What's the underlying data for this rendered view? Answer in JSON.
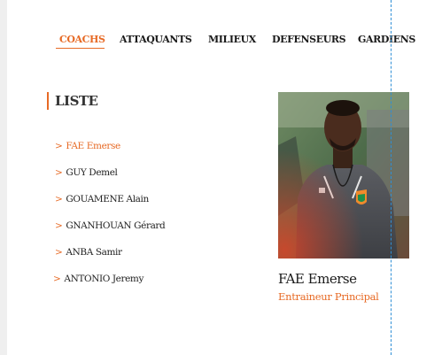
{
  "tabs": [
    {
      "label": "COACHS",
      "active": true
    },
    {
      "label": "ATTAQUANTS",
      "active": false
    },
    {
      "label": "MILIEUX",
      "active": false
    },
    {
      "label": "DEFENSEURS",
      "active": false
    },
    {
      "label": "GARDIENS",
      "active": false
    }
  ],
  "list": {
    "title": "LISTE",
    "chevron": ">",
    "items": [
      {
        "name": "FAE Emerse",
        "active": true
      },
      {
        "name": "GUY Demel",
        "active": false
      },
      {
        "name": "GOUAMENE Alain",
        "active": false
      },
      {
        "name": "GNANHOUAN Gérard",
        "active": false
      },
      {
        "name": "ANBA Samir",
        "active": false
      },
      {
        "name": "ANTONIO Jeremy",
        "active": false
      }
    ]
  },
  "selected": {
    "name": "FAE Emerse",
    "role": "Entraineur Principal"
  },
  "colors": {
    "accent": "#e76a25",
    "guide": "#2f8fd6"
  }
}
